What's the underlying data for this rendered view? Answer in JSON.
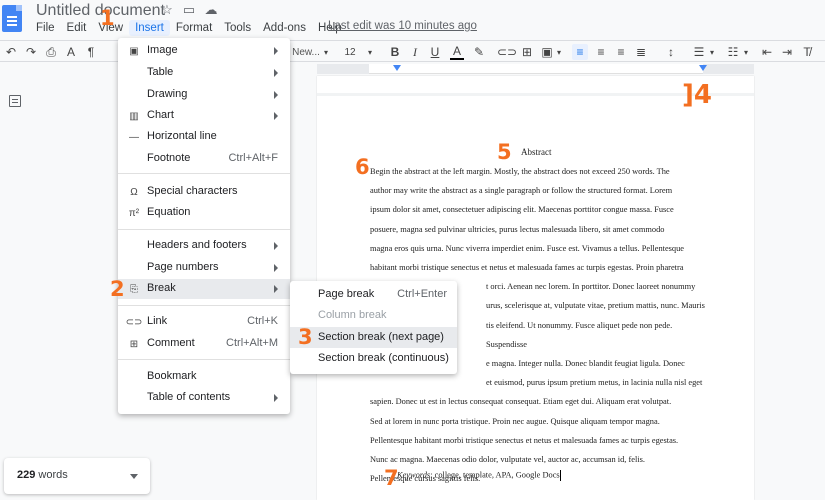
{
  "title_bar": {
    "doc_title": "Untitled document",
    "icons": [
      "star-icon",
      "folder-icon",
      "cloud-icon"
    ]
  },
  "menubar": {
    "items": [
      "File",
      "Edit",
      "View",
      "Insert",
      "Format",
      "Tools",
      "Add-ons",
      "Help"
    ],
    "last_edit": "Last edit was 10 minutes ago"
  },
  "toolbar": {
    "font_name": "New...",
    "font_size": "12"
  },
  "insert_menu": {
    "items": [
      {
        "label": "Image",
        "icon": "image-icon",
        "submenu": true
      },
      {
        "label": "Table",
        "icon": "",
        "submenu": true
      },
      {
        "label": "Drawing",
        "icon": "",
        "submenu": true
      },
      {
        "label": "Chart",
        "icon": "chart-icon",
        "submenu": true
      },
      {
        "label": "Horizontal line",
        "icon": "horizontal-line-icon",
        "submenu": false
      },
      {
        "label": "Footnote",
        "icon": "",
        "shortcut": "Ctrl+Alt+F"
      },
      {
        "label": "Special characters",
        "icon": "omega-icon",
        "submenu": false
      },
      {
        "label": "Equation",
        "icon": "pi-icon",
        "submenu": false
      },
      {
        "label": "Headers and footers",
        "icon": "",
        "submenu": true
      },
      {
        "label": "Page numbers",
        "icon": "",
        "submenu": true
      },
      {
        "label": "Break",
        "icon": "page-break-icon",
        "submenu": true
      },
      {
        "label": "Link",
        "icon": "link-icon",
        "shortcut": "Ctrl+K"
      },
      {
        "label": "Comment",
        "icon": "comment-icon",
        "shortcut": "Ctrl+Alt+M"
      },
      {
        "label": "Bookmark",
        "icon": "",
        "submenu": false
      },
      {
        "label": "Table of contents",
        "icon": "",
        "submenu": true
      }
    ]
  },
  "break_submenu": {
    "items": [
      {
        "label": "Page break",
        "shortcut": "Ctrl+Enter",
        "disabled": false
      },
      {
        "label": "Column break",
        "shortcut": "",
        "disabled": true
      },
      {
        "label": "Section break (next page)",
        "shortcut": "",
        "disabled": false
      },
      {
        "label": "Section break (continuous)",
        "shortcut": "",
        "disabled": false
      }
    ]
  },
  "document": {
    "heading": "Abstract",
    "lines": [
      "Begin the abstract at the left margin. Mostly, the abstract does not exceed 250 words. The",
      "author may write the abstract as a single paragraph or follow the structured format. Lorem",
      "ipsum dolor sit amet, consectetuer adipiscing elit. Maecenas porttitor congue massa. Fusce",
      "posuere, magna sed pulvinar ultricies, purus lectus malesuada libero, sit amet commodo",
      "magna eros quis urna. Nunc viverra imperdiet enim. Fusce est. Vivamus a tellus. Pellentesque",
      "habitant morbi tristique senectus et netus et malesuada fames ac turpis egestas. Proin pharetra",
      "t orci. Aenean nec lorem. In porttitor. Donec laoreet nonummy",
      "urus, scelerisque at, vulputate vitae, pretium mattis, nunc. Mauris",
      "tis eleifend. Ut nonummy. Fusce aliquet pede non pede. Suspendisse",
      "e magna. Integer nulla. Donec blandit feugiat ligula. Donec",
      "et euismod, purus ipsum pretium metus, in lacinia nulla nisl eget",
      "sapien. Donec ut est in lectus consequat consequat. Etiam eget dui. Aliquam erat volutpat.",
      "Sed at lorem in nunc porta tristique. Proin nec augue. Quisque aliquam tempor magna.",
      "Pellentesque habitant morbi tristique senectus et netus et malesuada fames ac turpis egestas.",
      "Nunc ac magna. Maecenas odio dolor, vulputate vel, auctor ac, accumsan id, felis.",
      "Pellentesque cursus sagittis felis."
    ],
    "keywords_label": "Keywords",
    "keywords_value": ": college, template, APA, Google Docs"
  },
  "word_count": {
    "number": "229",
    "label": "words"
  },
  "annotations": [
    "1",
    "2",
    "3",
    "]4",
    "5",
    "6",
    "7"
  ],
  "colors": {
    "accent": "#1a73e8",
    "annotation": "#f36f21",
    "doc_blue": "#4285f4"
  }
}
